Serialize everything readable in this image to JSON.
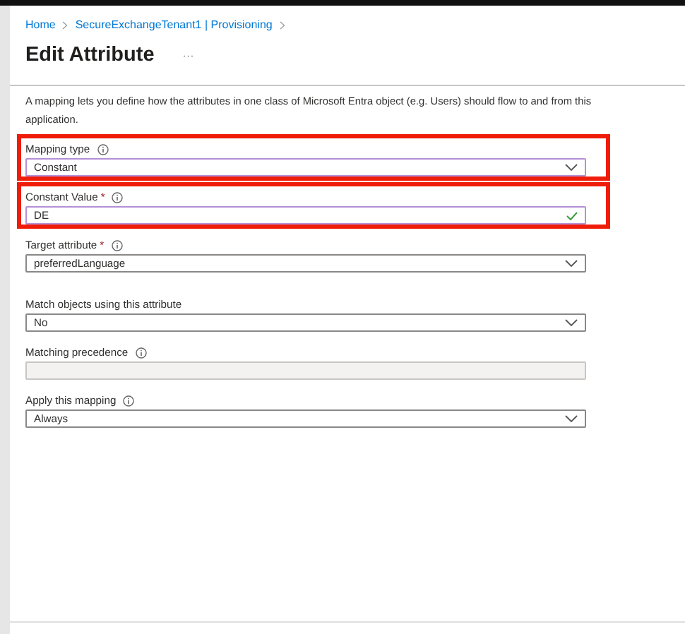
{
  "breadcrumb": [
    {
      "label": "Home"
    },
    {
      "label": "SecureExchangeTenant1 | Provisioning"
    }
  ],
  "title": "Edit Attribute",
  "more": "···",
  "description": "A mapping lets you define how the attributes in one class of Microsoft Entra object (e.g. Users) should flow to and from this application.",
  "fields": [
    {
      "label": "Mapping type",
      "kind": "select",
      "value": "Constant",
      "info": true,
      "highlighted": true
    },
    {
      "label": "Constant Value",
      "required_mark": "*",
      "kind": "text",
      "value": "DE",
      "info": true,
      "highlighted": true,
      "valid": true
    },
    {
      "label": "Target attribute",
      "required_mark": "*",
      "kind": "select",
      "value": "preferredLanguage",
      "info": true,
      "highlighted": false
    },
    {
      "label": "Match objects using this attribute",
      "kind": "select",
      "value": "No",
      "info": false,
      "highlighted": false
    },
    {
      "label": "Matching precedence",
      "kind": "disabled",
      "info": true,
      "highlighted": false
    },
    {
      "label": "Apply this mapping",
      "kind": "select",
      "value": "Always",
      "info": true,
      "highlighted": false
    }
  ]
}
